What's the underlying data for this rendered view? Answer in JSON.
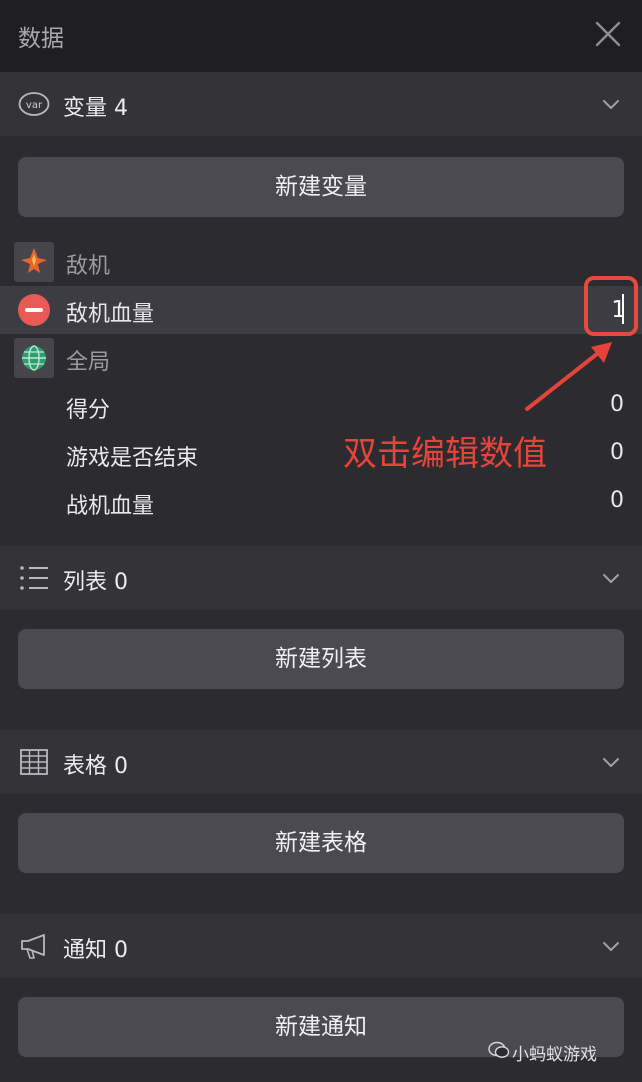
{
  "window": {
    "title": "数据"
  },
  "variables": {
    "header": "变量 4",
    "icon_label": "var",
    "new_button": "新建变量",
    "groups": [
      {
        "name": "敌机",
        "icon": "fighter-plane-icon",
        "items": [
          {
            "name": "敌机血量",
            "value": "1",
            "editing": true
          }
        ]
      },
      {
        "name": "全局",
        "icon": "globe-icon",
        "items": [
          {
            "name": "得分",
            "value": "0"
          },
          {
            "name": "游戏是否结束",
            "value": "0"
          },
          {
            "name": "战机血量",
            "value": "0"
          }
        ]
      }
    ]
  },
  "lists": {
    "header": "列表 0",
    "new_button": "新建列表"
  },
  "tables": {
    "header": "表格 0",
    "new_button": "新建表格"
  },
  "notifications": {
    "header": "通知 0",
    "new_button": "新建通知"
  },
  "annotation": {
    "text": "双击编辑数值",
    "color": "#e6443a"
  },
  "watermark": {
    "text": "小蚂蚁游戏"
  },
  "colors": {
    "accent_red": "#e85a55",
    "background": "#2b2b30",
    "header": "#333338"
  }
}
